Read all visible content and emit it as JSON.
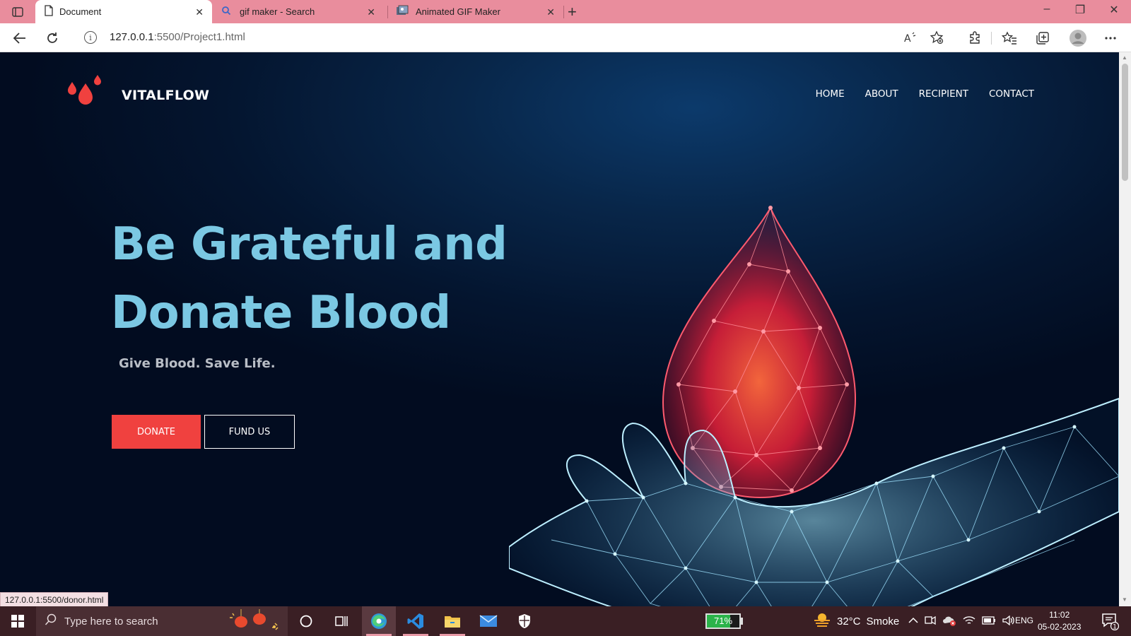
{
  "browser": {
    "tabs": [
      {
        "title": "Document"
      },
      {
        "title": "gif maker - Search"
      },
      {
        "title": "Animated GIF Maker"
      }
    ],
    "address": {
      "host": "127.0.0.1",
      "path": ":5500/Project1.html"
    },
    "status_url": "127.0.0.1:5500/donor.html",
    "icons": [
      "tab-actions-icon",
      "document-icon",
      "search-icon",
      "gif-maker-icon",
      "close-icon",
      "plus-icon",
      "minimize-icon",
      "restore-icon",
      "back-icon",
      "refresh-icon",
      "info-icon",
      "read-aloud-icon",
      "favorite-add-icon",
      "extensions-icon",
      "favorites-icon",
      "collections-icon",
      "profile-icon",
      "more-icon"
    ]
  },
  "site": {
    "brand": "VITALFLOW",
    "nav": [
      {
        "label": "HOME"
      },
      {
        "label": "ABOUT"
      },
      {
        "label": "RECIPIENT"
      },
      {
        "label": "CONTACT"
      }
    ],
    "hero": {
      "title_line1": "Be Grateful and",
      "title_line2": "Donate Blood",
      "subtitle": "Give Blood. Save Life.",
      "primary_button": "DONATE",
      "secondary_button": "FUND US"
    },
    "colors": {
      "accent_red": "#f0413f",
      "title_blue": "#7bc8e3",
      "background": "#04152f"
    }
  },
  "taskbar": {
    "search_placeholder": "Type here to search",
    "battery": {
      "text": "71%",
      "level": 0.71
    },
    "weather": {
      "temp": "32°C",
      "condition": "Smoke"
    },
    "language": "ENG",
    "time": "11:02",
    "date": "05-02-2023",
    "notification_count": "1",
    "colors": {
      "bar": "#3a1f24",
      "battery": "#2bb34a"
    }
  }
}
